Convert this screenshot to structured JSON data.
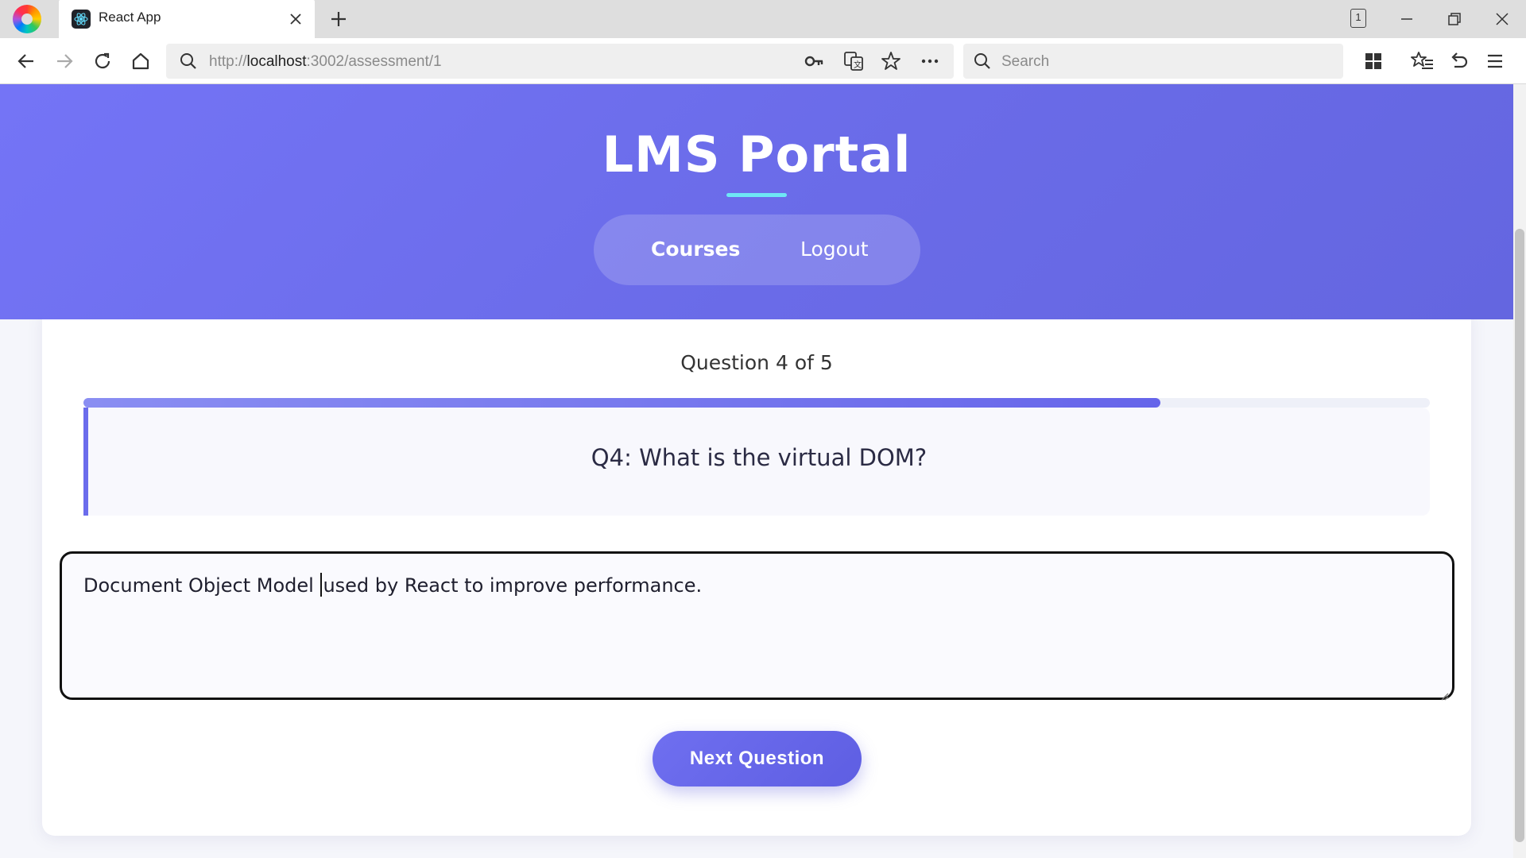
{
  "browser": {
    "tab_title": "React App",
    "tab_count": "1",
    "url_prefix": "http://",
    "url_host": "localhost",
    "url_rest": ":3002/assessment/1",
    "search_placeholder": "Search"
  },
  "header": {
    "title": "LMS Portal",
    "nav": {
      "courses": "Courses",
      "logout": "Logout"
    }
  },
  "assessment": {
    "counter": "Question 4 of 5",
    "progress": 0.8,
    "question": "Q4: What is the virtual DOM?",
    "answer_before_caret": "Document Object Model ",
    "answer_after_caret": "used by React to improve performance.",
    "next_button": "Next Question"
  },
  "colors": {
    "header_gradient_start": "#7474f6",
    "header_gradient_end": "#6466e0",
    "accent": "#6b6cec",
    "underline": "#6ee7f5"
  },
  "icons": {
    "browser_logo": "browser-logo-icon",
    "favicon": "react-icon",
    "back": "arrow-left-icon",
    "forward": "arrow-right-icon",
    "reload": "reload-icon",
    "home": "home-icon",
    "key": "key-icon",
    "translate": "translate-icon",
    "bookmark": "star-icon",
    "more": "more-icon",
    "search": "search-icon"
  }
}
